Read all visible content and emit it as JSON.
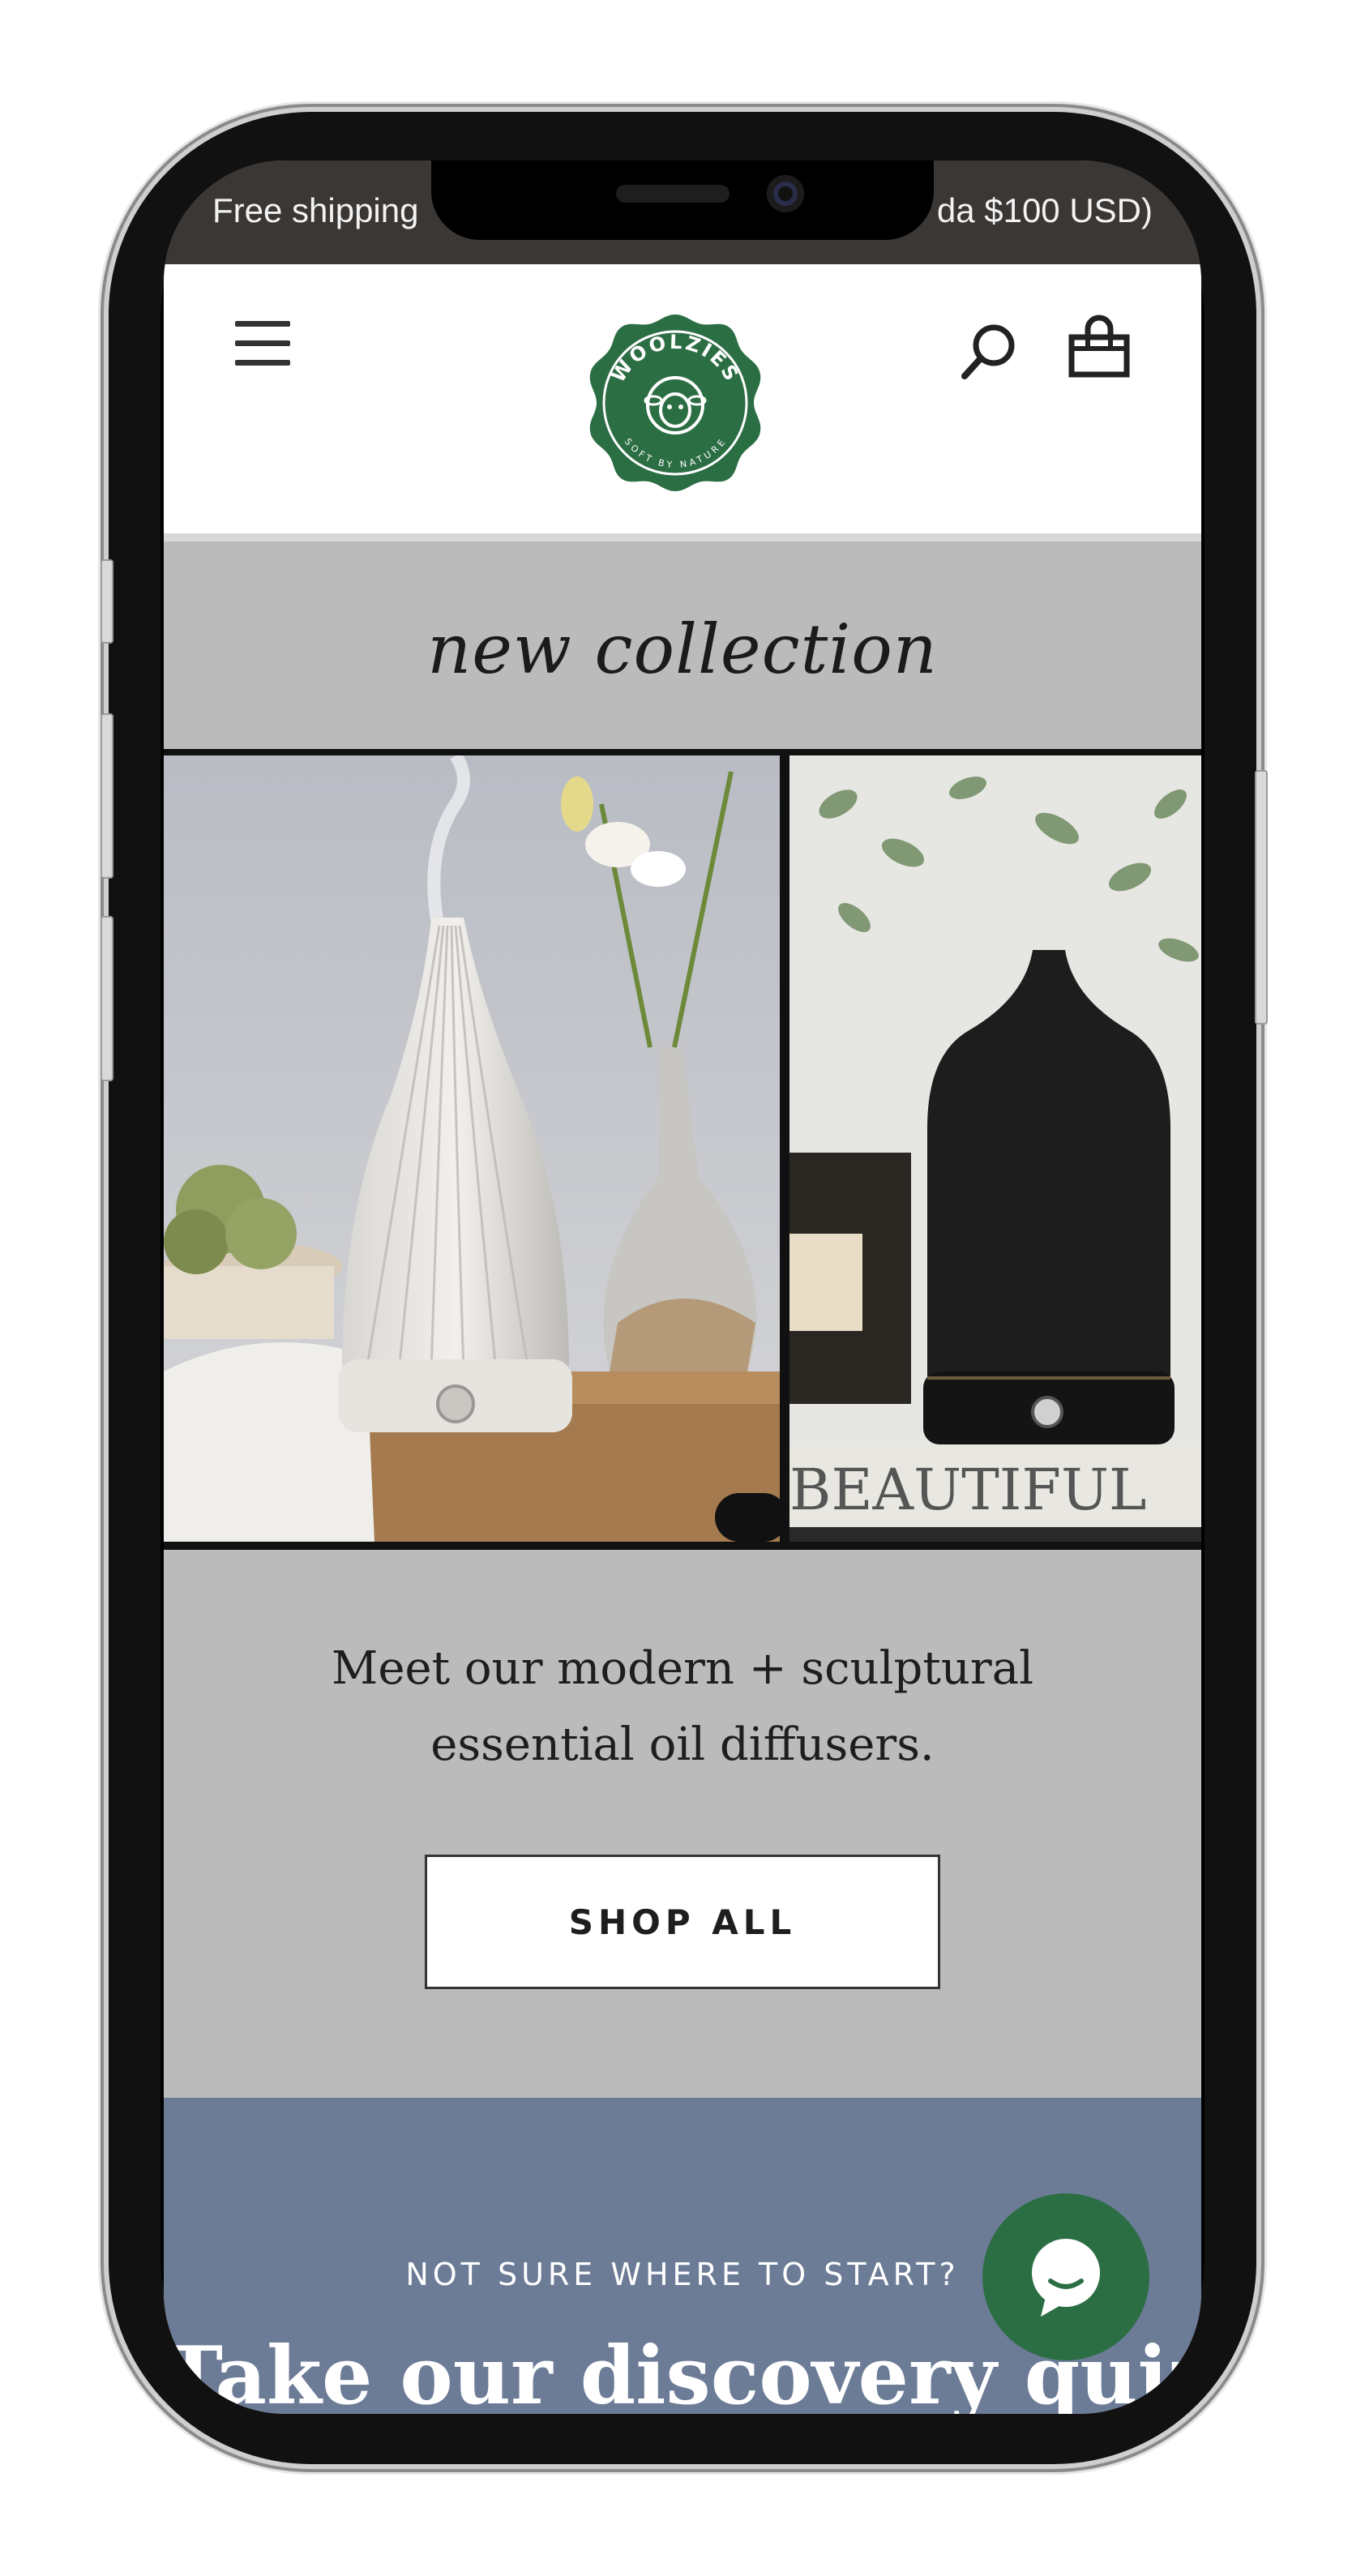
{
  "announcement": {
    "left_text": "Free shipping",
    "right_text": "da $100 USD)"
  },
  "header": {
    "logo": {
      "brand": "WOOLZIES",
      "tagline": "SOFT BY NATURE",
      "color": "#2c6e44"
    },
    "icons": [
      "menu-icon",
      "search-icon",
      "bag-icon"
    ]
  },
  "collection": {
    "heading": "new collection",
    "slides": [
      {
        "icon": "white-ceramic-diffuser-image"
      },
      {
        "icon": "black-ceramic-diffuser-image",
        "book_text": "BEAUTIFUL"
      }
    ]
  },
  "promo": {
    "text_line1": "Meet our modern + sculptural",
    "text_line2": "essential oil diffusers.",
    "cta_label": "SHOP ALL"
  },
  "quiz": {
    "eyebrow": "NOT SURE WHERE TO START?",
    "title": "Take our discovery quiz!",
    "background": "#6c7b96"
  },
  "chat": {
    "icon": "chat-bubble-icon",
    "color": "#2c6e44"
  }
}
